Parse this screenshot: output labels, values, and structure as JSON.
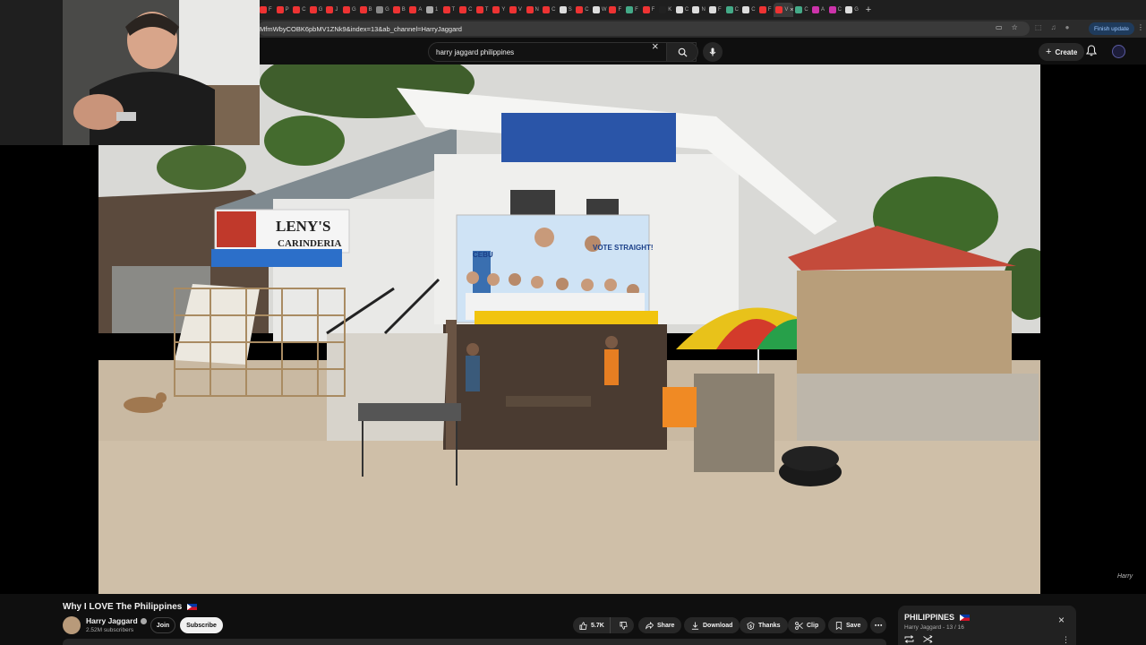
{
  "browser": {
    "tabs": [
      {
        "label": "F",
        "fav": "#e33"
      },
      {
        "label": "P",
        "fav": "#e33"
      },
      {
        "label": "C",
        "fav": "#e33"
      },
      {
        "label": "G",
        "fav": "#e33"
      },
      {
        "label": "J",
        "fav": "#e33"
      },
      {
        "label": "G",
        "fav": "#e33"
      },
      {
        "label": "B",
        "fav": "#e33"
      },
      {
        "label": "G",
        "fav": "#888"
      },
      {
        "label": "B",
        "fav": "#e33"
      },
      {
        "label": "A",
        "fav": "#e33"
      },
      {
        "label": "1",
        "fav": "#aaa"
      },
      {
        "label": "T",
        "fav": "#e33"
      },
      {
        "label": "C",
        "fav": "#e33"
      },
      {
        "label": "T",
        "fav": "#e33"
      },
      {
        "label": "Y",
        "fav": "#e33"
      },
      {
        "label": "V",
        "fav": "#e33"
      },
      {
        "label": "N",
        "fav": "#e33"
      },
      {
        "label": "C",
        "fav": "#e33"
      },
      {
        "label": "S",
        "fav": "#ddd"
      },
      {
        "label": "C",
        "fav": "#e33"
      },
      {
        "label": "W",
        "fav": "#ddd"
      },
      {
        "label": "F",
        "fav": "#e33"
      },
      {
        "label": "F",
        "fav": "#4a8"
      },
      {
        "label": "F",
        "fav": "#e33"
      },
      {
        "label": "K",
        "fav": "#222"
      },
      {
        "label": "C",
        "fav": "#ddd"
      },
      {
        "label": "N",
        "fav": "#ddd"
      },
      {
        "label": "F",
        "fav": "#ddd"
      },
      {
        "label": "C",
        "fav": "#4a8"
      },
      {
        "label": "C",
        "fav": "#ddd"
      },
      {
        "label": "F",
        "fav": "#e33"
      }
    ],
    "active_tab": {
      "label": "V",
      "close": "×"
    },
    "trailing_tabs": [
      {
        "label": "C",
        "fav": "#4a8"
      },
      {
        "label": "A",
        "fav": "#c3a"
      },
      {
        "label": "C",
        "fav": "#c3a"
      },
      {
        "label": "G",
        "fav": "#ddd"
      }
    ],
    "new_tab": "+",
    "url": "MfmWbyCOBK6pbMV1ZNk9&index=13&ab_channel=HarryJaggard",
    "finish_update": "Finish update"
  },
  "masthead": {
    "search_value": "harry jaggard philippines",
    "create_label": "Create"
  },
  "video": {
    "sign_name": "LENY'S",
    "sign_sub": "CARINDERIA",
    "banner_place": "CEBU",
    "banner_slogan": "VOTE STRAIGHT!",
    "watermark": "Harry"
  },
  "meta": {
    "title": "Why I LOVE The Philippines",
    "channel_name": "Harry Jaggard",
    "subscribers": "2.52M subscribers",
    "join_label": "Join",
    "subscribe_label": "Subscribe",
    "like_count": "5.7K",
    "share_label": "Share",
    "download_label": "Download",
    "thanks_label": "Thanks",
    "clip_label": "Clip",
    "save_label": "Save"
  },
  "playlist": {
    "title": "PHILIPPINES",
    "subtitle": "Harry Jaggard - 13 / 16"
  }
}
